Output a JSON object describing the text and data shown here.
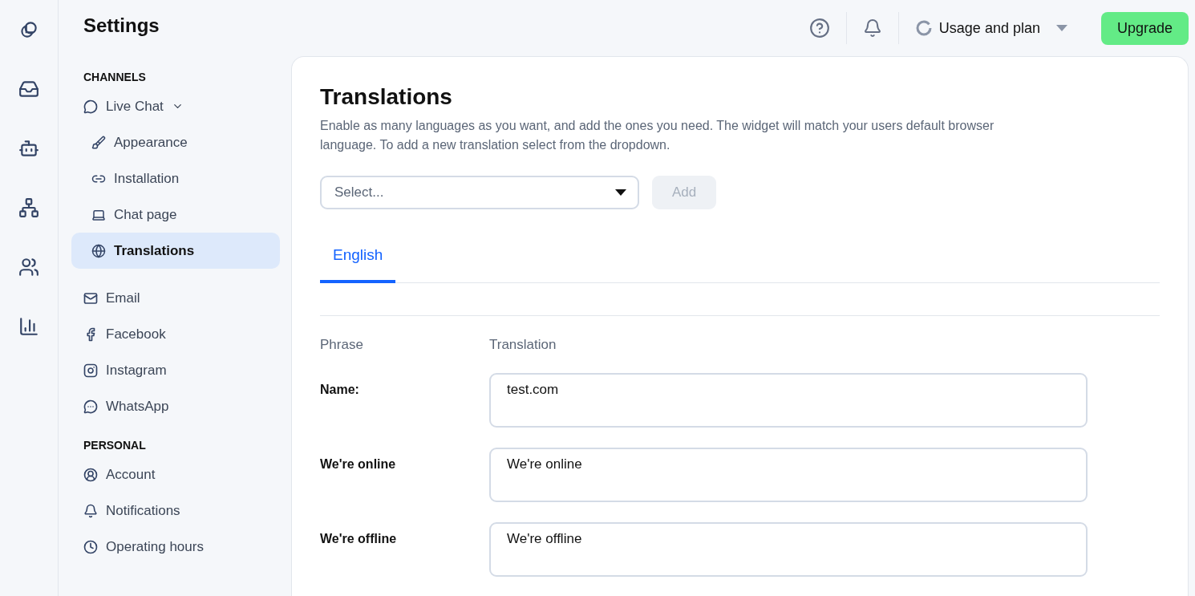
{
  "header": {
    "title": "Settings",
    "usage": "Usage and plan",
    "upgrade": "Upgrade"
  },
  "rail": [
    {
      "selected": false
    },
    {
      "selected": false
    },
    {
      "selected": false
    },
    {
      "selected": false
    },
    {
      "selected": false
    },
    {
      "selected": false
    }
  ],
  "sidebar": [
    {
      "heading": "CHANNELS",
      "items": [
        {
          "label": "Live Chat",
          "selected": false,
          "expanded": true,
          "children": [
            {
              "label": "Appearance",
              "selected": false
            },
            {
              "label": "Installation",
              "selected": false
            },
            {
              "label": "Chat page",
              "selected": false
            },
            {
              "label": "Translations",
              "selected": true
            }
          ]
        },
        {
          "label": "Email",
          "selected": false
        },
        {
          "label": "Facebook",
          "selected": false
        },
        {
          "label": "Instagram",
          "selected": false
        },
        {
          "label": "WhatsApp",
          "selected": false
        }
      ]
    },
    {
      "heading": "PERSONAL",
      "items": [
        {
          "label": "Account",
          "selected": false
        },
        {
          "label": "Notifications",
          "selected": false
        },
        {
          "label": "Operating hours",
          "selected": false
        }
      ]
    }
  ],
  "content": {
    "title": "Translations",
    "description": "Enable as many languages as you want, and add the ones you need. The widget will match your users default browser language. To add a new translation select from the dropdown.",
    "select": {
      "placeholder": "Select..."
    },
    "add_button": {
      "label": "Add",
      "disabled": true
    },
    "tabs": [
      {
        "label": "English",
        "selected": true
      }
    ],
    "columns": [
      "Phrase",
      "Translation"
    ],
    "rows": [
      {
        "phrase": "Name:",
        "translation": "test.com"
      },
      {
        "phrase": "We're online",
        "translation": "We're online"
      },
      {
        "phrase": "We're offline",
        "translation": "We're offline"
      }
    ]
  }
}
